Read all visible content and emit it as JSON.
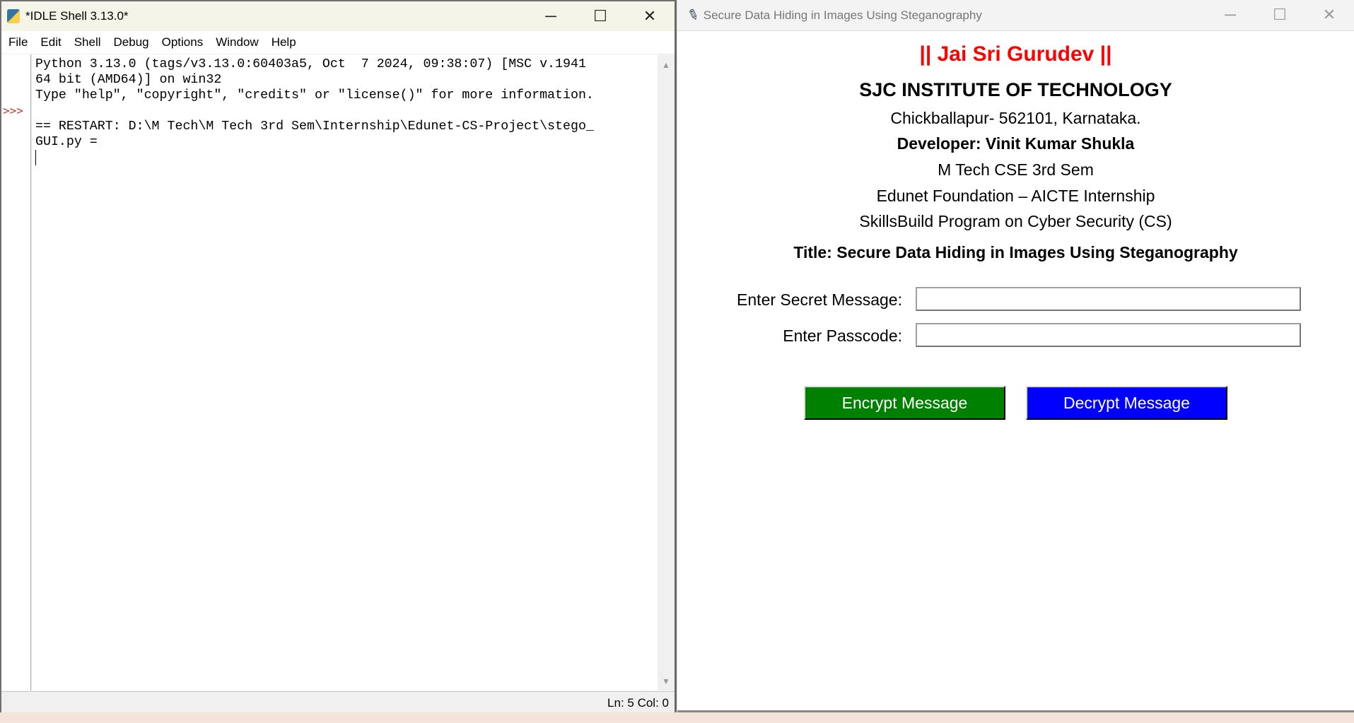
{
  "idle": {
    "title": "*IDLE Shell 3.13.0*",
    "menu": [
      "File",
      "Edit",
      "Shell",
      "Debug",
      "Options",
      "Window",
      "Help"
    ],
    "prompt": ">>>",
    "lines": [
      "Python 3.13.0 (tags/v3.13.0:60403a5, Oct  7 2024, 09:38:07) [MSC v.1941",
      "64 bit (AMD64)] on win32",
      "Type \"help\", \"copyright\", \"credits\" or \"license()\" for more information.",
      "",
      "== RESTART: D:\\M Tech\\M Tech 3rd Sem\\Internship\\Edunet-CS-Project\\stego_",
      "GUI.py ="
    ],
    "status": "Ln: 5   Col: 0"
  },
  "stego": {
    "title": "Secure Data Hiding in Images Using Steganography",
    "greeting": "|| Jai Sri Gurudev ||",
    "institute": "SJC INSTITUTE OF TECHNOLOGY",
    "address": "Chickballapur- 562101, Karnataka.",
    "developer": "Developer: Vinit Kumar Shukla",
    "course": "M Tech CSE 3rd Sem",
    "internship": "Edunet Foundation – AICTE Internship",
    "program": "SkillsBuild Program on Cyber Security (CS)",
    "project_title": "Title: Secure Data Hiding in Images Using Steganography",
    "secret_label": "Enter Secret Message:",
    "secret_value": "",
    "passcode_label": "Enter Passcode:",
    "passcode_value": "",
    "encrypt_label": "Encrypt Message",
    "decrypt_label": "Decrypt Message",
    "colors": {
      "greeting": "#ff0000",
      "encrypt": "#008000",
      "decrypt": "#0000ff"
    }
  }
}
